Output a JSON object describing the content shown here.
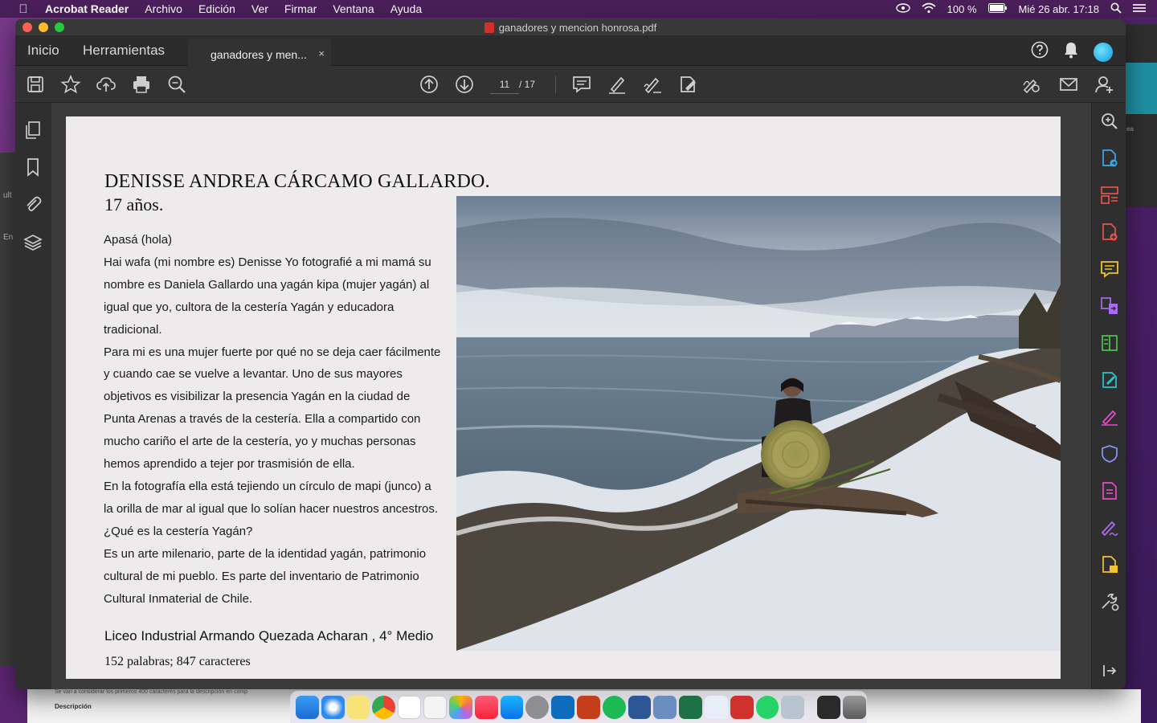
{
  "menubar": {
    "app": "Acrobat Reader",
    "items": [
      "Archivo",
      "Edición",
      "Ver",
      "Firmar",
      "Ventana",
      "Ayuda"
    ],
    "battery": "100 %",
    "datetime": "Mié 26 abr.  17:18"
  },
  "window": {
    "title": "ganadores y mencion honrosa.pdf"
  },
  "tabs": {
    "home": "Inicio",
    "tools": "Herramientas",
    "doc": "ganadores y men...",
    "close": "×"
  },
  "toolbar": {
    "page_current": "11",
    "page_total": "/ 17"
  },
  "document": {
    "name": "DENISSE ANDREA CÁRCAMO GALLARDO.",
    "age": "17 años.",
    "lines": [
      "Apasá (hola)",
      "Hai wafa (mi nombre es) Denisse Yo fotografié a mi mamá su",
      "nombre es Daniela Gallardo una yagán kipa (mujer yagán) al",
      "igual que yo, cultora de la cestería Yagán y educadora",
      "tradicional.",
      "Para mi es una mujer fuerte por qué no se deja caer fácilmente",
      "y cuando cae se vuelve a levantar. Uno de sus mayores",
      "objetivos es visibilizar la presencia Yagán en la ciudad de",
      "Punta Arenas a través de la cestería. Ella a compartido con",
      "mucho cariño el arte de la cestería, yo y muchas personas",
      "hemos aprendido a tejer por trasmisión de ella.",
      "En la fotografía ella está tejiendo un círculo de mapi (junco) a",
      "la orilla de mar al igual que lo solían hacer nuestros ancestros.",
      "¿Qué es la cestería Yagán?",
      "Es un arte milenario, parte de la identidad yagán, patrimonio",
      "cultural de mi pueblo. Es parte del inventario de Patrimonio",
      "Cultural Inmaterial de Chile."
    ],
    "school": "Liceo Industrial Armando Quezada Acharan , 4° Medio",
    "count": "152 palabras; 847 caracteres"
  },
  "background": {
    "left_a": "ult",
    "left_b": "En",
    "right_a": "ea",
    "bottom_note": "Se van a considerar los primeros 400 caracteres para la descripción en comp",
    "bottom_label": "Descripción"
  },
  "colors": {
    "accent": "#1598d8",
    "tool_blue": "#3ea7e6",
    "tool_red": "#e8534b",
    "tool_purple": "#a86cf0",
    "tool_pink": "#e64ac8",
    "tool_yellow": "#f2c230",
    "tool_green": "#4fc24f"
  }
}
